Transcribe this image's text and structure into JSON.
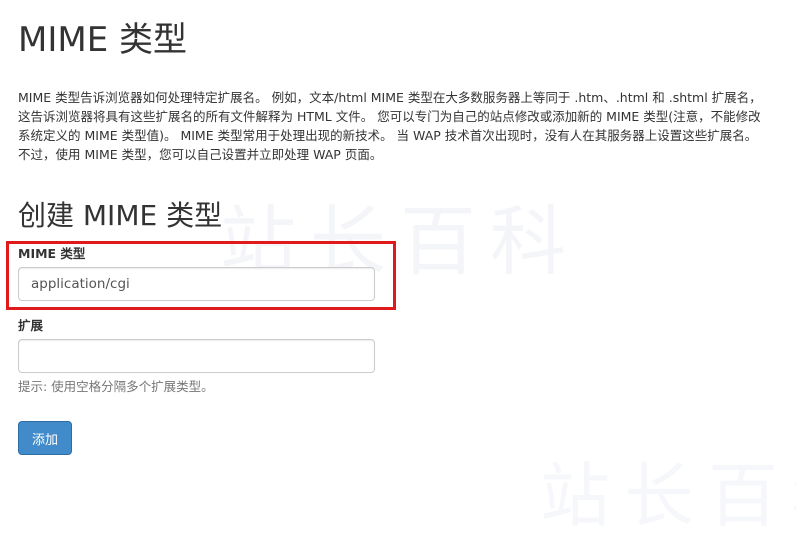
{
  "page": {
    "title": "MIME 类型",
    "description": "MIME 类型告诉浏览器如何处理特定扩展名。 例如，文本/html MIME 类型在大多数服务器上等同于 .htm、.html 和 .shtml 扩展名，这告诉浏览器将具有这些扩展名的所有文件解释为 HTML 文件。 您可以专门为自己的站点修改或添加新的 MIME 类型(注意，不能修改系统定义的 MIME 类型值)。 MIME 类型常用于处理出现的新技术。 当 WAP 技术首次出现时，没有人在其服务器上设置这些扩展名。 不过，使用 MIME 类型，您可以自己设置并立即处理 WAP 页面。"
  },
  "form": {
    "section_title": "创建 MIME 类型",
    "mime_label": "MIME 类型",
    "mime_value": "application/cgi",
    "extension_label": "扩展",
    "extension_value": "",
    "help_text": "提示: 使用空格分隔多个扩展类型。",
    "add_button_label": "添加"
  },
  "watermark": {
    "text": "站长百科"
  },
  "colors": {
    "primary_button": "#428bca",
    "highlight": "#e01a1a"
  }
}
